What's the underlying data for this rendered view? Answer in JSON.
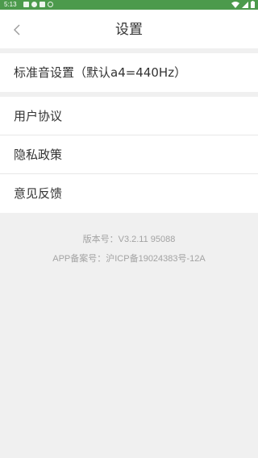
{
  "status_bar": {
    "time": "5:13"
  },
  "header": {
    "title": "设置",
    "back_icon": "chevron-left-icon"
  },
  "settings": {
    "standard_pitch": "标准音设置（默认a4=440Hz）",
    "items": [
      {
        "label": "用户协议"
      },
      {
        "label": "隐私政策"
      },
      {
        "label": "意见反馈"
      }
    ]
  },
  "footer": {
    "version": "版本号：V3.2.11  95088",
    "icp": "APP备案号：沪ICP备19024383号-12A"
  },
  "colors": {
    "status_bar": "#4c9a4c",
    "background": "#f0f0f0",
    "text": "#333333",
    "footer_text": "#a3a3a3"
  }
}
